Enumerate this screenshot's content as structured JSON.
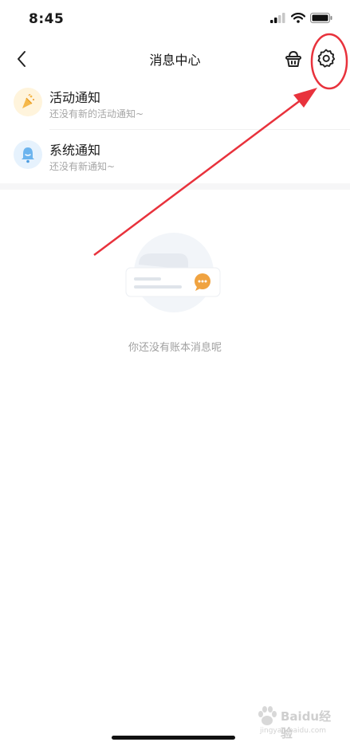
{
  "status_bar": {
    "time": "8:45"
  },
  "header": {
    "title": "消息中心"
  },
  "notifications": [
    {
      "title": "活动通知",
      "subtitle": "还没有新的活动通知~",
      "icon": "party-popper-icon",
      "color": "#f5b84a"
    },
    {
      "title": "系统通知",
      "subtitle": "还没有新通知~",
      "icon": "bell-icon",
      "color": "#6cb4ee"
    }
  ],
  "empty_state": {
    "message": "你还没有账本消息呢"
  },
  "watermark": {
    "brand": "Baidu经验",
    "url": "jingyan.baidu.com"
  },
  "colors": {
    "annotation_red": "#e8323c",
    "accent_orange": "#f0a340"
  }
}
